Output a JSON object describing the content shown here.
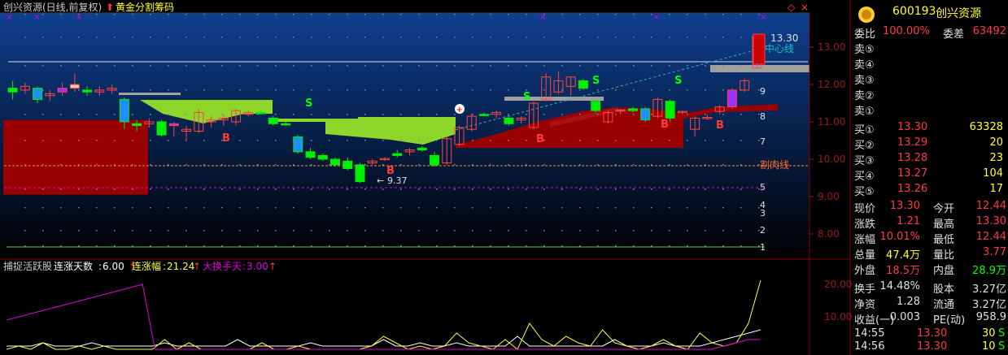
{
  "header": {
    "title": "创兴资源(日线,前复权)",
    "indicator_name": "黄金分割筹码",
    "diamond_glyph": "◇",
    "close_glyph": "×"
  },
  "colors": {
    "up": "#ff3b3b",
    "down": "#00ff00",
    "bg": "#000000",
    "panel_top": "#0e3f8f",
    "panel_bottom": "#000000",
    "red_area": "#990000",
    "green_area": "#8fd62a",
    "magenta": "#dd00dd",
    "yellow": "#ffff33",
    "white": "#ffffff",
    "cyan": "#00c8c8"
  },
  "chart_data": [
    {
      "type": "candlestick",
      "title": "创兴资源(日线,前复权)",
      "y_axis_ticks": [
        "8.00",
        "9.00",
        "10.00",
        "11.00",
        "12.00",
        "13.00"
      ],
      "ylim": [
        7.4,
        13.4
      ],
      "level_labels": [
        "1",
        "2",
        "3",
        "4",
        "5",
        "7",
        "8",
        "9"
      ],
      "annotations": {
        "high_label": "13.30",
        "low_label": "9.37",
        "center_line": "中心线",
        "cut_line": "割肉线",
        "sell_marker": "S",
        "buy_marker": "B"
      },
      "candles": [
        {
          "o": 11.9,
          "h": 12.1,
          "l": 11.6,
          "c": 11.8
        },
        {
          "o": 11.85,
          "h": 12.05,
          "l": 11.75,
          "c": 11.95
        },
        {
          "o": 11.9,
          "h": 11.95,
          "l": 11.5,
          "c": 11.6
        },
        {
          "o": 11.7,
          "h": 11.85,
          "l": 11.55,
          "c": 11.75
        },
        {
          "o": 11.8,
          "h": 12.05,
          "l": 11.7,
          "c": 11.9
        },
        {
          "o": 11.9,
          "h": 12.3,
          "l": 11.8,
          "c": 12.0
        },
        {
          "o": 11.85,
          "h": 11.95,
          "l": 11.7,
          "c": 11.8
        },
        {
          "o": 11.8,
          "h": 11.95,
          "l": 11.7,
          "c": 11.85
        },
        {
          "o": 11.85,
          "h": 12.0,
          "l": 11.75,
          "c": 11.9
        },
        {
          "o": 11.6,
          "h": 11.65,
          "l": 10.8,
          "c": 11.0
        },
        {
          "o": 10.95,
          "h": 11.05,
          "l": 10.75,
          "c": 10.9
        },
        {
          "o": 10.95,
          "h": 11.1,
          "l": 10.85,
          "c": 11.0
        },
        {
          "o": 11.0,
          "h": 11.05,
          "l": 10.6,
          "c": 10.65
        },
        {
          "o": 10.9,
          "h": 11.0,
          "l": 10.6,
          "c": 10.95
        },
        {
          "o": 10.75,
          "h": 10.9,
          "l": 10.5,
          "c": 10.8
        },
        {
          "o": 10.75,
          "h": 11.35,
          "l": 10.7,
          "c": 11.25
        },
        {
          "o": 11.0,
          "h": 11.15,
          "l": 10.85,
          "c": 11.05
        },
        {
          "o": 11.05,
          "h": 11.2,
          "l": 10.9,
          "c": 11.1
        },
        {
          "o": 11.0,
          "h": 11.35,
          "l": 10.9,
          "c": 11.3
        },
        {
          "o": 11.2,
          "h": 11.3,
          "l": 11.15,
          "c": 11.25
        },
        {
          "o": 11.25,
          "h": 11.3,
          "l": 11.2,
          "c": 11.22
        },
        {
          "o": 11.1,
          "h": 11.15,
          "l": 10.9,
          "c": 10.95
        },
        {
          "o": 10.95,
          "h": 11.0,
          "l": 10.9,
          "c": 10.93
        },
        {
          "o": 10.6,
          "h": 10.65,
          "l": 10.15,
          "c": 10.2
        },
        {
          "o": 10.2,
          "h": 10.3,
          "l": 10.0,
          "c": 10.05
        },
        {
          "o": 10.1,
          "h": 10.15,
          "l": 9.95,
          "c": 10.0
        },
        {
          "o": 10.0,
          "h": 10.05,
          "l": 9.8,
          "c": 9.85
        },
        {
          "o": 9.95,
          "h": 10.05,
          "l": 9.7,
          "c": 9.75
        },
        {
          "o": 9.85,
          "h": 9.9,
          "l": 9.37,
          "c": 9.4
        },
        {
          "o": 9.9,
          "h": 10.0,
          "l": 9.85,
          "c": 9.95
        },
        {
          "o": 10.0,
          "h": 10.05,
          "l": 9.95,
          "c": 10.02
        },
        {
          "o": 10.15,
          "h": 10.25,
          "l": 10.05,
          "c": 10.1
        },
        {
          "o": 10.2,
          "h": 10.3,
          "l": 10.1,
          "c": 10.25
        },
        {
          "o": 10.3,
          "h": 10.35,
          "l": 10.2,
          "c": 10.25
        },
        {
          "o": 10.1,
          "h": 10.2,
          "l": 9.8,
          "c": 9.85
        },
        {
          "o": 9.9,
          "h": 10.6,
          "l": 9.85,
          "c": 10.55
        },
        {
          "o": 10.4,
          "h": 10.9,
          "l": 10.35,
          "c": 10.85
        },
        {
          "o": 10.8,
          "h": 11.2,
          "l": 10.75,
          "c": 11.15
        },
        {
          "o": 11.2,
          "h": 11.25,
          "l": 11.15,
          "c": 11.18
        },
        {
          "o": 11.2,
          "h": 11.3,
          "l": 11.1,
          "c": 11.25
        },
        {
          "o": 11.1,
          "h": 11.15,
          "l": 10.9,
          "c": 10.95
        },
        {
          "o": 11.05,
          "h": 11.15,
          "l": 10.95,
          "c": 11.1
        },
        {
          "o": 10.85,
          "h": 11.55,
          "l": 10.8,
          "c": 11.5
        },
        {
          "o": 11.6,
          "h": 12.3,
          "l": 11.55,
          "c": 12.2
        },
        {
          "o": 11.8,
          "h": 12.35,
          "l": 11.75,
          "c": 12.1
        },
        {
          "o": 11.95,
          "h": 12.2,
          "l": 11.7,
          "c": 12.2
        },
        {
          "o": 12.1,
          "h": 12.15,
          "l": 11.85,
          "c": 11.9
        },
        {
          "o": 11.55,
          "h": 11.6,
          "l": 11.25,
          "c": 11.3
        },
        {
          "o": 11.0,
          "h": 11.3,
          "l": 10.95,
          "c": 11.25
        },
        {
          "o": 11.3,
          "h": 11.35,
          "l": 11.2,
          "c": 11.32
        },
        {
          "o": 11.35,
          "h": 11.4,
          "l": 11.25,
          "c": 11.3
        },
        {
          "o": 11.35,
          "h": 11.4,
          "l": 11.0,
          "c": 11.05
        },
        {
          "o": 11.15,
          "h": 11.65,
          "l": 11.1,
          "c": 11.6
        },
        {
          "o": 11.55,
          "h": 11.6,
          "l": 11.0,
          "c": 11.1
        },
        {
          "o": 11.25,
          "h": 11.3,
          "l": 11.2,
          "c": 11.28
        },
        {
          "o": 10.8,
          "h": 11.15,
          "l": 10.6,
          "c": 11.1
        },
        {
          "o": 11.1,
          "h": 11.2,
          "l": 11.05,
          "c": 11.12
        },
        {
          "o": 11.28,
          "h": 11.45,
          "l": 11.2,
          "c": 11.4
        },
        {
          "o": 11.4,
          "h": 11.9,
          "l": 11.35,
          "c": 11.85
        },
        {
          "o": 11.85,
          "h": 12.15,
          "l": 11.8,
          "c": 12.1
        },
        {
          "o": 12.44,
          "h": 13.3,
          "l": 12.44,
          "c": 13.3
        }
      ]
    },
    {
      "type": "line",
      "title": "捕捉活跃股",
      "y_axis_ticks": [
        "10.00",
        "20.00"
      ],
      "ylim": [
        0,
        23
      ],
      "series": [
        {
          "name": "连涨天数",
          "value_text": "6.00",
          "color": "#ffffff",
          "values": [
            1,
            1,
            1,
            2,
            1,
            1,
            1,
            2,
            1,
            1,
            1,
            1,
            1,
            2,
            1,
            1,
            1,
            1,
            1,
            3,
            1,
            1,
            1,
            1,
            1,
            2,
            1,
            1,
            1,
            1,
            1,
            3,
            1,
            1,
            2,
            1,
            1,
            2,
            1,
            1,
            1,
            1,
            4,
            1,
            1,
            1,
            1,
            1,
            1,
            1,
            3,
            1,
            1,
            1,
            2,
            1,
            1,
            1,
            2,
            3,
            4,
            5,
            6
          ]
        },
        {
          "name": "连涨幅",
          "value_text": "21.24",
          "color": "#ffff33",
          "values": [
            0,
            1,
            0,
            2,
            0,
            0,
            1,
            0,
            1,
            0,
            0,
            0,
            0,
            3,
            0,
            2,
            0,
            0,
            0,
            0,
            0,
            2,
            0,
            0,
            1,
            0,
            0,
            0,
            0,
            0,
            1,
            4,
            2,
            0,
            1,
            0,
            1,
            5,
            2,
            1,
            0,
            3,
            0,
            8,
            3,
            1,
            4,
            2,
            1,
            6,
            2,
            1,
            0,
            1,
            3,
            1,
            0,
            5,
            2,
            1,
            2,
            8,
            21.24
          ]
        },
        {
          "name": "大换手天",
          "value_text": "3.00",
          "color": "#dd00dd",
          "values": [
            9,
            10,
            11,
            12,
            13,
            14,
            15,
            16,
            17,
            18,
            19,
            20,
            0,
            0,
            0,
            0,
            0,
            0,
            0,
            0,
            0,
            0,
            0,
            0,
            0,
            0,
            0,
            0,
            0,
            0,
            0,
            0,
            0,
            0,
            0,
            0,
            0,
            0,
            0,
            0,
            0,
            0,
            0,
            0,
            0,
            0,
            0,
            0,
            0,
            0,
            0,
            0,
            0,
            0,
            0,
            0,
            0,
            0,
            1,
            2,
            3,
            3
          ]
        }
      ]
    }
  ],
  "quote": {
    "code": "600193",
    "name": "创兴资源",
    "ratio_label": "委比",
    "ratio_value": "100.00%",
    "diff_label": "委差",
    "diff_value": "63492",
    "asks": [
      {
        "label": "卖⑤",
        "price": "",
        "vol": ""
      },
      {
        "label": "卖④",
        "price": "",
        "vol": ""
      },
      {
        "label": "卖③",
        "price": "",
        "vol": ""
      },
      {
        "label": "卖②",
        "price": "",
        "vol": ""
      },
      {
        "label": "卖①",
        "price": "",
        "vol": ""
      }
    ],
    "bids": [
      {
        "label": "买①",
        "price": "13.30",
        "vol": "63328"
      },
      {
        "label": "买②",
        "price": "13.29",
        "vol": "20"
      },
      {
        "label": "买③",
        "price": "13.28",
        "vol": "23"
      },
      {
        "label": "买④",
        "price": "13.27",
        "vol": "104"
      },
      {
        "label": "买⑤",
        "price": "13.26",
        "vol": "17"
      }
    ],
    "stats": [
      {
        "l1": "现价",
        "v1": "13.30",
        "c1": "#ff3b3b",
        "l2": "今开",
        "v2": "12.44",
        "c2": "#ff3b3b"
      },
      {
        "l1": "涨跌",
        "v1": "1.21",
        "c1": "#ff3b3b",
        "l2": "最高",
        "v2": "13.30",
        "c2": "#ff3b3b"
      },
      {
        "l1": "涨幅",
        "v1": "10.01%",
        "c1": "#ff3b3b",
        "l2": "最低",
        "v2": "12.44",
        "c2": "#ff3b3b"
      },
      {
        "l1": "总量",
        "v1": "47.4万",
        "c1": "#ffff33",
        "l2": "量比",
        "v2": "3.77",
        "c2": "#ff3b3b"
      },
      {
        "l1": "外盘",
        "v1": "18.5万",
        "c1": "#ff3b3b",
        "l2": "内盘",
        "v2": "28.9万",
        "c2": "#00ff00"
      }
    ],
    "stats2": [
      {
        "l1": "换手",
        "v1": "14.48%",
        "l2": "股本",
        "v2": "3.27亿"
      },
      {
        "l1": "净资",
        "v1": "1.28",
        "l2": "流通",
        "v2": "3.27亿"
      },
      {
        "l1": "收益(一)",
        "v1": "0.003",
        "l2": "PE(动)",
        "v2": "958.9"
      }
    ],
    "ticks": [
      {
        "time": "14:55",
        "price": "13.30",
        "vol": "30",
        "flag": "S"
      },
      {
        "time": "14:56",
        "price": "13.30",
        "vol": "10",
        "flag": "S"
      }
    ]
  }
}
